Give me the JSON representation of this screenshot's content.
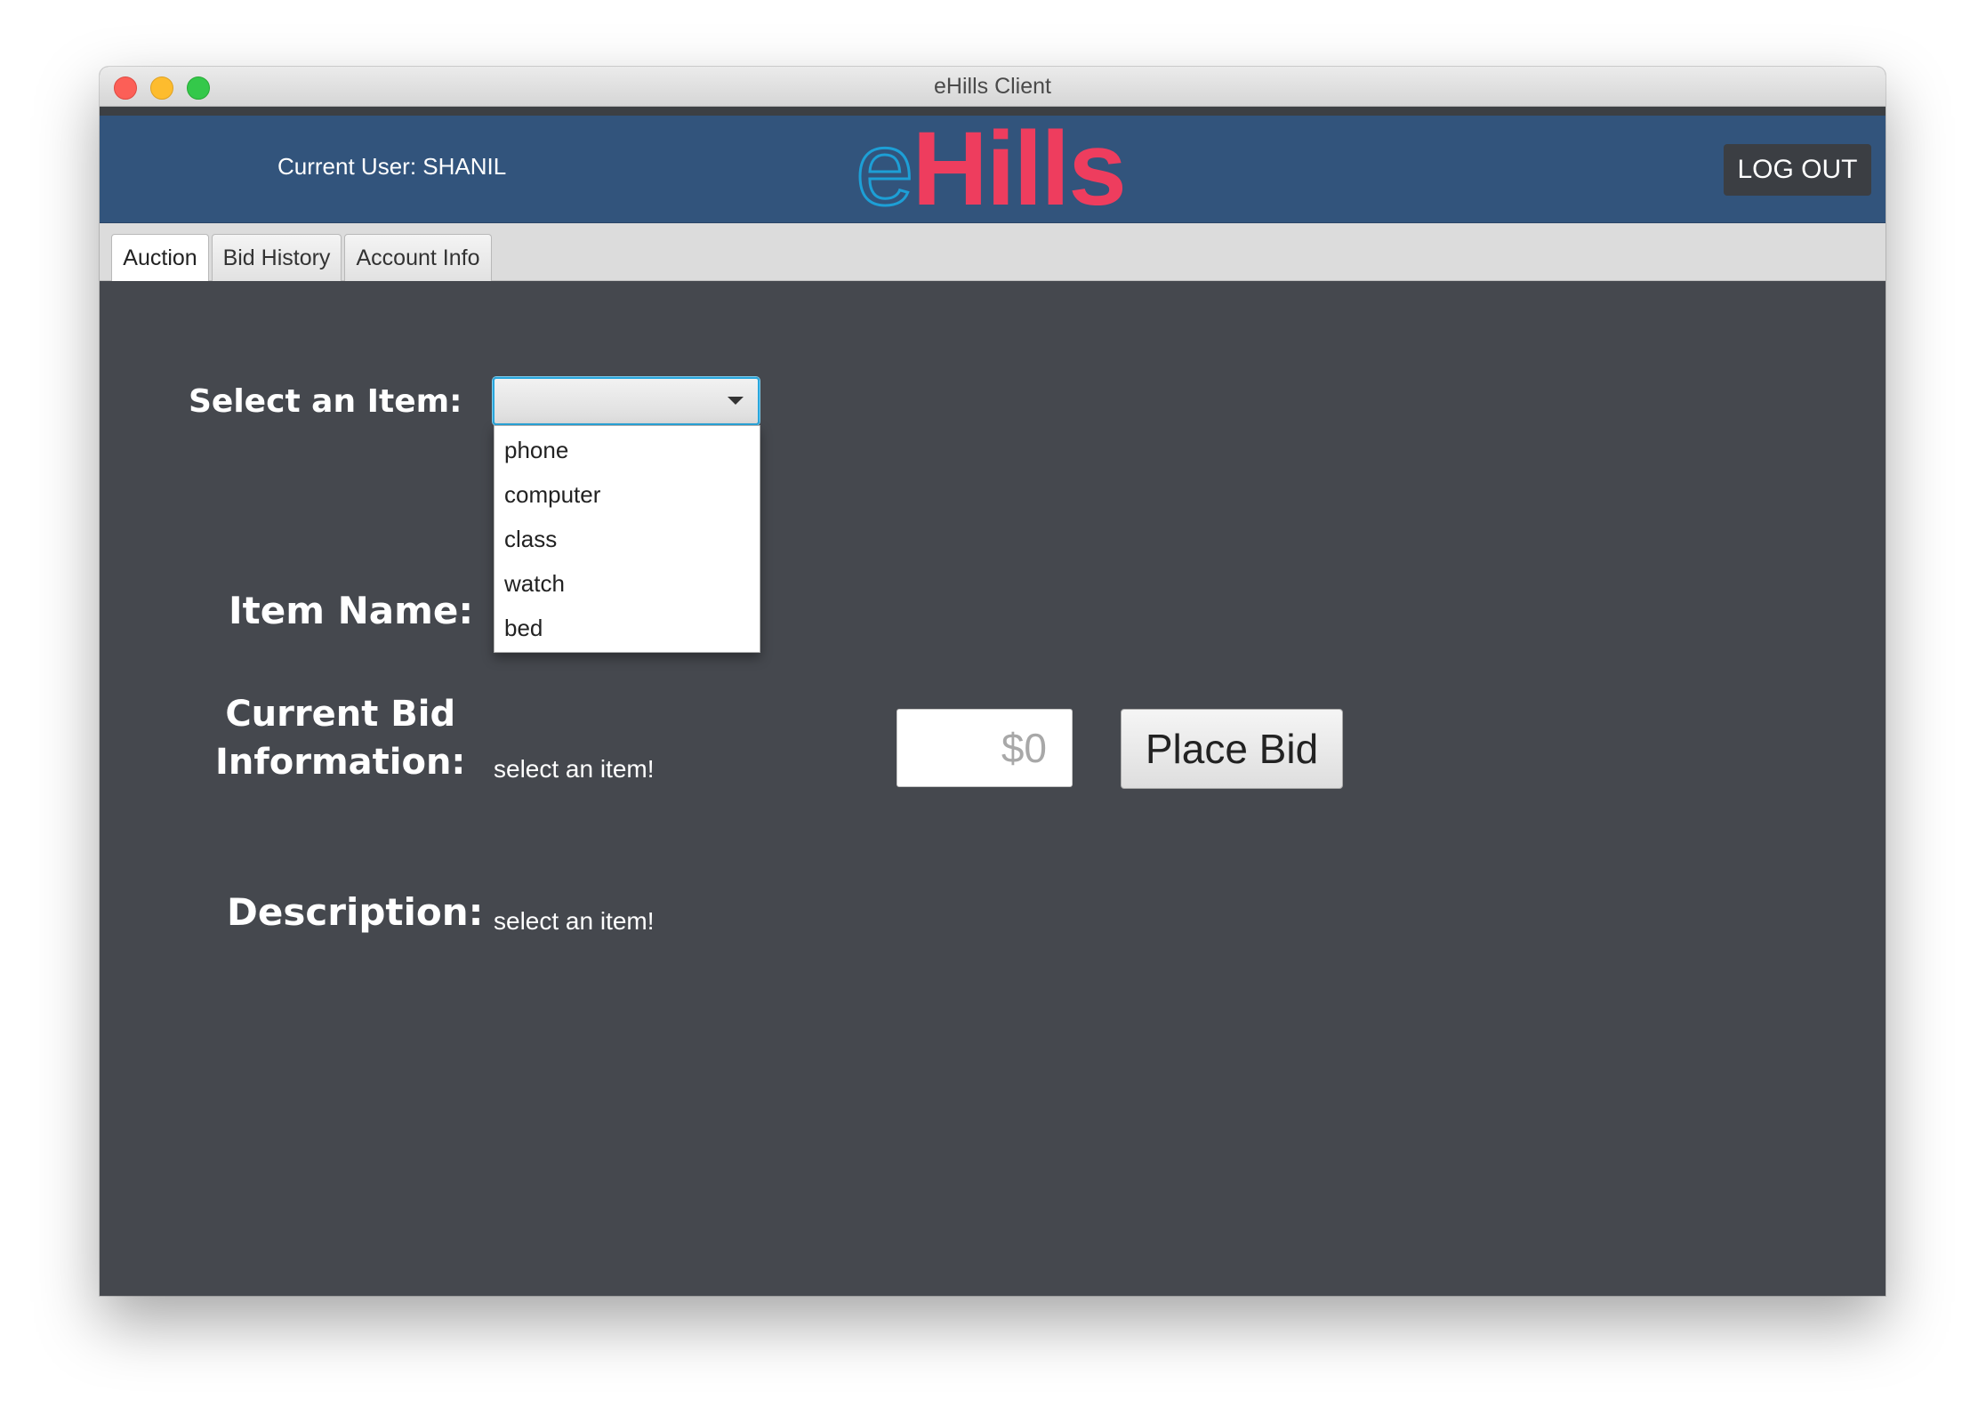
{
  "window": {
    "title": "eHills Client"
  },
  "header": {
    "current_user": "Current User: SHANIL",
    "logo_e": "e",
    "logo_rest": "Hills",
    "logout_label": "LOG OUT"
  },
  "tabs": [
    {
      "label": "Auction",
      "active": true
    },
    {
      "label": "Bid History",
      "active": false
    },
    {
      "label": "Account Info",
      "active": false
    }
  ],
  "form": {
    "select_label": "Select an Item:",
    "select_value": "",
    "options": [
      "phone",
      "computer",
      "class",
      "watch",
      "bed"
    ],
    "item_name_label": "Item Name:",
    "current_bid_label_line1": "Current Bid",
    "current_bid_label_line2": "Information:",
    "current_bid_value": "select an item!",
    "description_label": "Description:",
    "description_value": "select an item!",
    "bid_placeholder": "$0",
    "place_bid_label": "Place Bid"
  },
  "colors": {
    "header_bg": "#32547c",
    "content_bg": "#45484e",
    "logo_red": "#ee3d5e",
    "logo_blue": "#1d9fd6",
    "focus_blue": "#29a6dc"
  }
}
